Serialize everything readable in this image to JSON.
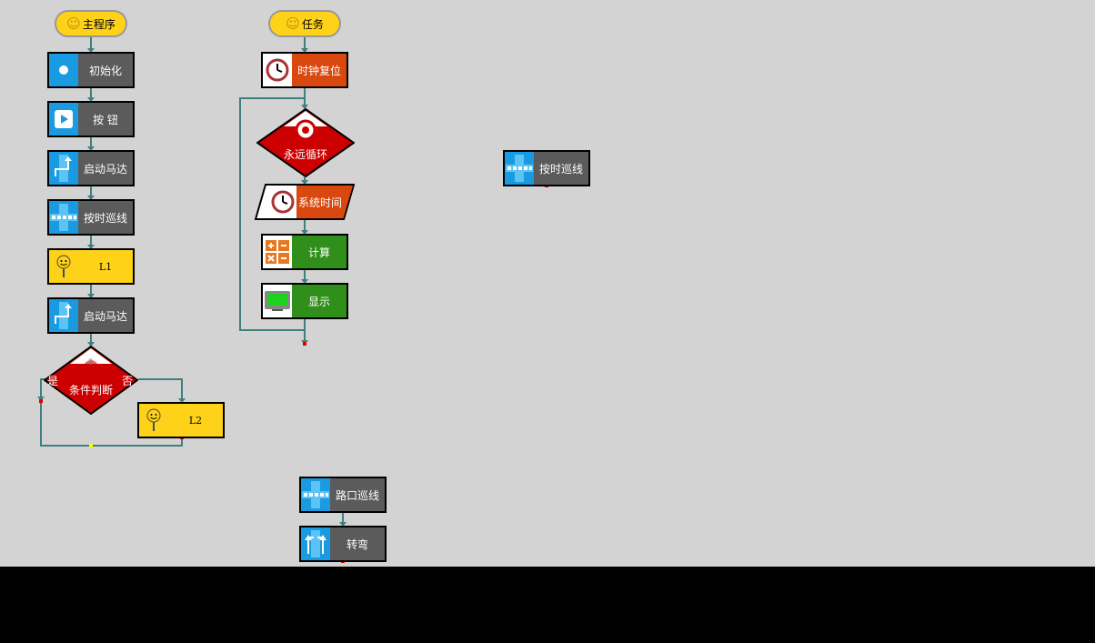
{
  "main": {
    "start_label": "主程序",
    "blocks": {
      "init": "初始化",
      "button": "按 钮",
      "motor1": "启动马达",
      "timed_line": "按时巡线",
      "l1": "L1",
      "motor2": "启动马达",
      "condition": "条件判断",
      "yes": "是",
      "no": "否",
      "l2": "L2"
    }
  },
  "task": {
    "start_label": "任务",
    "blocks": {
      "clock_reset": "时钟复位",
      "forever": "永远循环",
      "system_time": "系统时间",
      "compute": "计算",
      "display": "显示"
    }
  },
  "free_blocks": {
    "timed_line": "按时巡线",
    "junction_line": "路口巡线",
    "turn": "转弯"
  },
  "colors": {
    "canvas": "#d3d3d3",
    "gray_block": "#5b5b5b",
    "icon_blue": "#1a9ae0",
    "orange_block": "#d9480f",
    "green_block": "#2f8f1a",
    "yellow_block": "#ffd21a",
    "diamond_red": "#cc0000",
    "wire": "#3f7f80",
    "port_red": "#e00000"
  },
  "icons": {
    "init": "circle-icon",
    "button": "play-icon",
    "motor": "motor-arrow-icon",
    "line": "line-track-icon",
    "sub": "smiley-key-icon",
    "clock": "clock-icon",
    "compute": "calculator-icon",
    "display": "lcd-screen-icon",
    "turn": "turn-arrows-icon"
  }
}
